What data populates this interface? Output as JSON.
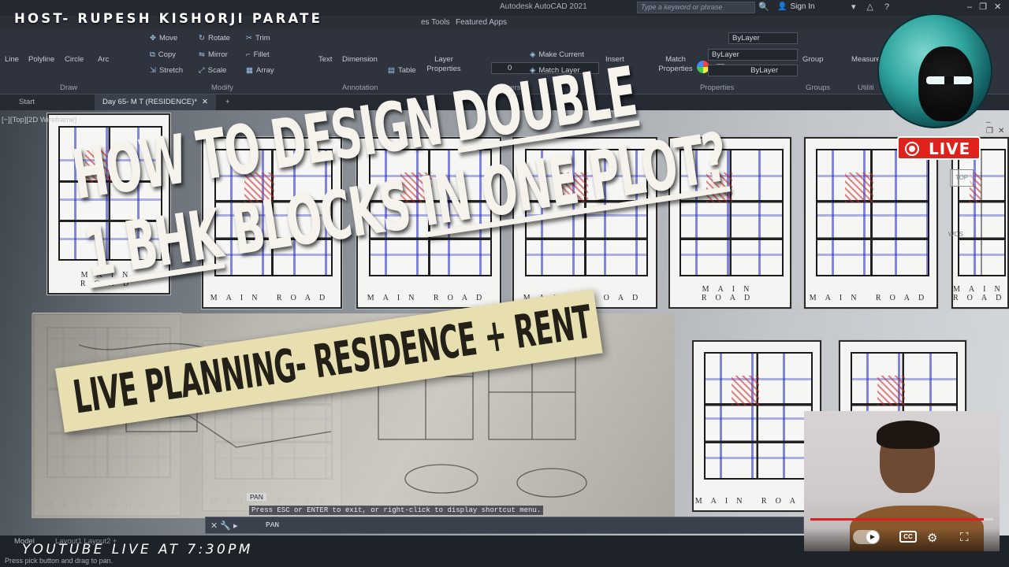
{
  "app": {
    "title": "Autodesk AutoCAD 2021",
    "search_placeholder": "Type a keyword or phrase",
    "sign_in": "Sign In"
  },
  "ribbon": {
    "tabs": [
      "es Tools",
      "Featured Apps"
    ],
    "draw": {
      "line": "Line",
      "polyline": "Polyline",
      "circle": "Circle",
      "arc": "Arc",
      "panel": "Draw"
    },
    "modify": {
      "move": "Move",
      "rotate": "Rotate",
      "trim": "Trim",
      "copy": "Copy",
      "mirror": "Mirror",
      "fillet": "Fillet",
      "stretch": "Stretch",
      "scale": "Scale",
      "array": "Array",
      "panel": "Modify"
    },
    "annotation": {
      "text": "Text",
      "dimension": "Dimension",
      "table": "Table",
      "panel": "Annotation"
    },
    "layers": {
      "layer_properties": "Layer Properties",
      "layer_value": "0",
      "make_current": "Make Current",
      "match_layer": "Match Layer",
      "panel": "Layers"
    },
    "block": {
      "insert": "Insert",
      "panel": "Block"
    },
    "properties": {
      "match_properties": "Match Properties",
      "bylayer_1": "ByLayer",
      "bylayer_2": "ByLayer",
      "bylayer_3": "ByLayer",
      "panel": "Properties"
    },
    "groups": {
      "group": "Group",
      "panel": "Groups"
    },
    "utilities": {
      "measure": "Measure",
      "panel": "Utiliti"
    }
  },
  "file_tabs": {
    "start": "Start",
    "active": "Day 65- M T (RESIDENCE)*",
    "add": "+"
  },
  "viewport": {
    "label": "[−][Top][2D Wireframe]",
    "cube_top": "TOP",
    "wcs": "WCS",
    "road_label": "MAIN ROAD"
  },
  "command": {
    "hint": "Press ESC or ENTER to exit, or right-click to display shortcut menu.",
    "input": "PAN",
    "pan_tag": "PAN"
  },
  "status": {
    "model": "Model",
    "layouts": "Layout1  Layout2  +",
    "pick_hint": "Press pick button and drag to pan."
  },
  "thumbnail": {
    "host": "HOST- RUPESH KISHORJI PARATE",
    "headline_1a": "HOW TO DESIGN ",
    "headline_1b": "DOUBLE",
    "headline_2a": "1 BHK",
    "headline_2b": " BLOCKS ",
    "headline_2c": "IN ONE PLOT?",
    "banner": "LIVE PLANNING-  RESIDENCE + RENT",
    "live": "LIVE",
    "footer": "YOUTUBE LIVE AT 7:30PM"
  },
  "webcam": {
    "progress": 0.95,
    "cc": "CC"
  },
  "colors": {
    "live_red": "#e0221c",
    "banner_bg": "#e8dfb0",
    "plan_blue": "#1e28c8",
    "teal_avatar": "#2fa69f"
  }
}
